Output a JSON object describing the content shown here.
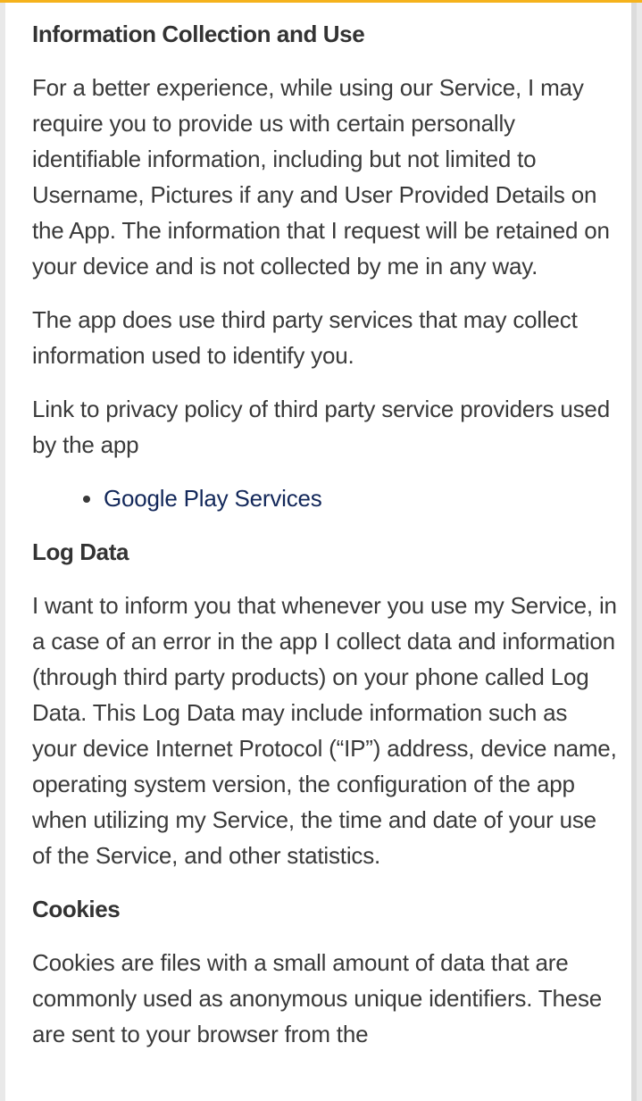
{
  "colors": {
    "accent_bar": "#f5b21b",
    "text": "#3a3a3a",
    "heading": "#333333",
    "link": "#13285a",
    "background": "#ffffff"
  },
  "sections": {
    "info": {
      "heading": "Information Collection and Use",
      "p1": "For a better experience, while using our Service, I may require you to provide us with certain personally identifiable information, including but not limited to Username, Pictures if any and User Provided Details on the App. The information that I request will be retained on your device and is not collected by me in any way.",
      "p2": "The app does use third party services that may collect information used to identify you.",
      "p3": "Link to privacy policy of third party service providers used by the app",
      "links": [
        "Google Play Services"
      ]
    },
    "log": {
      "heading": "Log Data",
      "p1": "I want to inform you that whenever you use my Service, in a case of an error in the app I collect data and information (through third party products) on your phone called Log Data. This Log Data may include information such as your device Internet Protocol (“IP”) address, device name, operating system version, the configuration of the app when utilizing my Service, the time and date of your use of the Service, and other statistics."
    },
    "cookies": {
      "heading": "Cookies",
      "p1": "Cookies are files with a small amount of data that are commonly used as anonymous unique identifiers. These are sent to your browser from the"
    }
  }
}
